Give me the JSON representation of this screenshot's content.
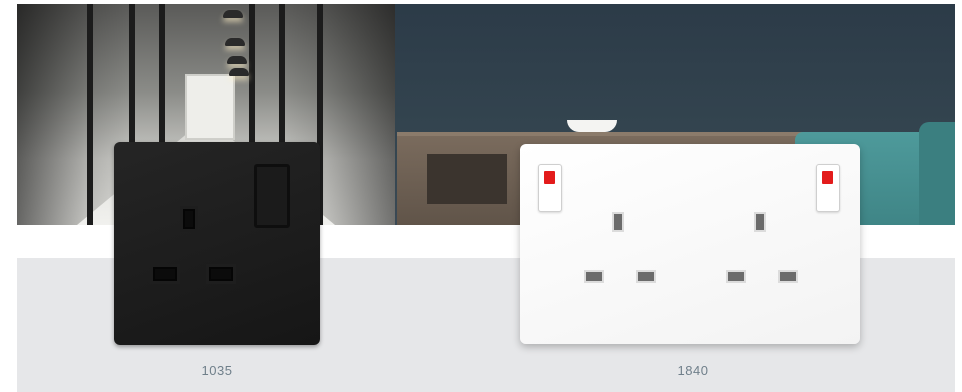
{
  "products": [
    {
      "label": "1035"
    },
    {
      "label": "1840"
    }
  ],
  "colors": {
    "band_background": "#e6e7e9",
    "label_text": "#6f7f8a",
    "neon_indicator": "#e31b1b"
  }
}
